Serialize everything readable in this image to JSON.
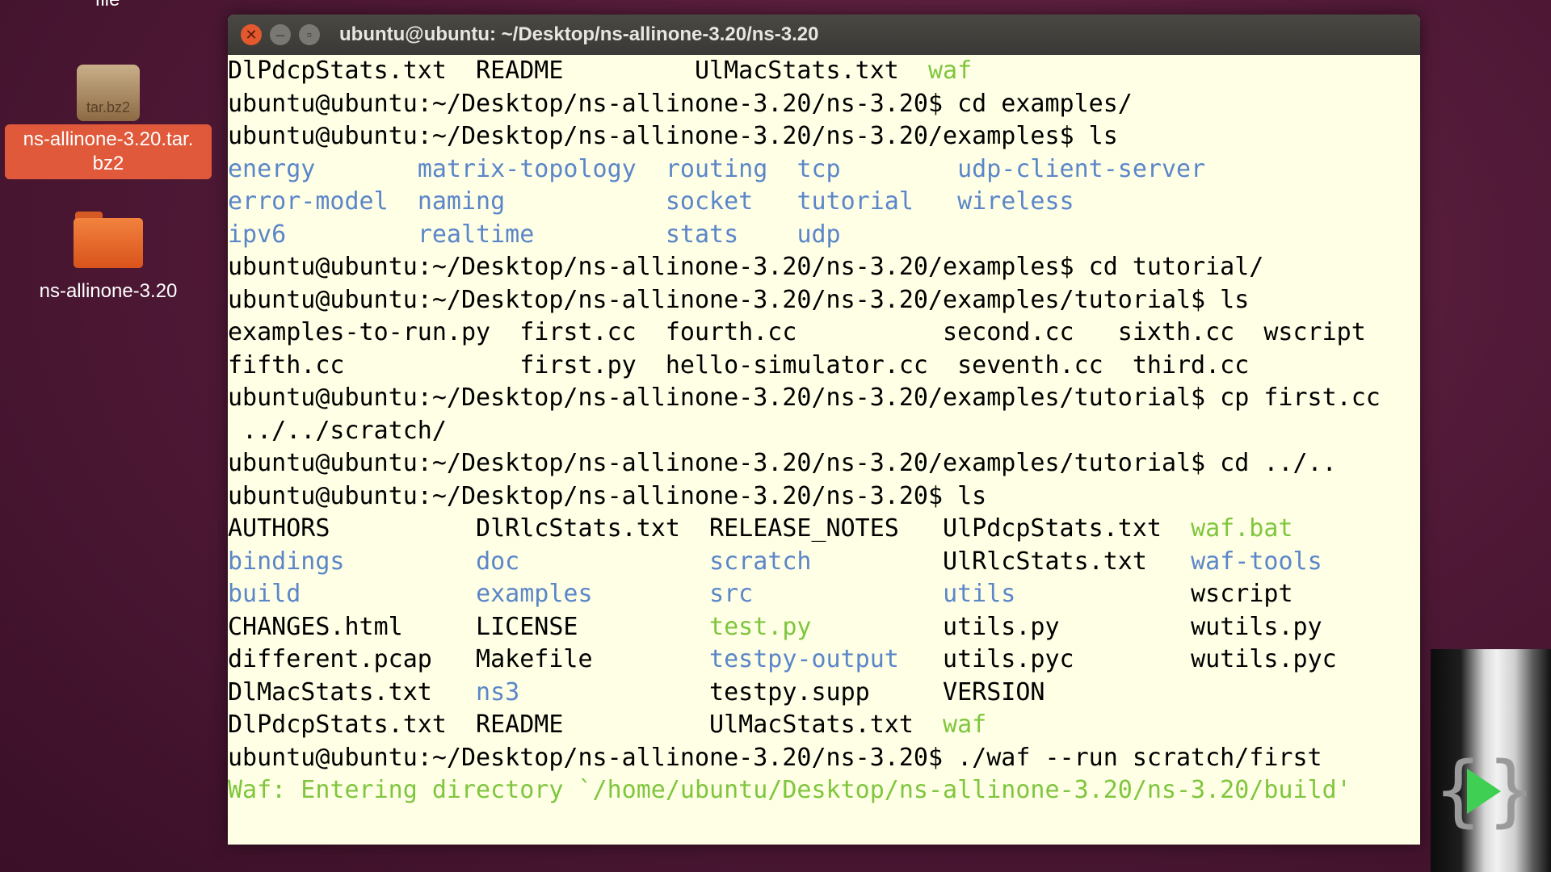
{
  "desktop": {
    "top_clipped_label": "file",
    "icons": [
      {
        "label": "ns-allinone-3.20.tar.\nbz2",
        "thumb_text": "tar.bz2"
      },
      {
        "label": "ns-allinone-3.20"
      }
    ]
  },
  "terminal": {
    "title": "ubuntu@ubuntu: ~/Desktop/ns-allinone-3.20/ns-3.20",
    "lines": [
      [
        {
          "t": "DlPdcpStats.txt  README         UlMacStats.txt  "
        },
        {
          "t": "waf",
          "c": "exe"
        }
      ],
      [
        {
          "t": "ubuntu@ubuntu:~/Desktop/ns-allinone-3.20/ns-3.20$ cd examples/"
        }
      ],
      [
        {
          "t": "ubuntu@ubuntu:~/Desktop/ns-allinone-3.20/ns-3.20/examples$ ls"
        }
      ],
      [
        {
          "t": "energy",
          "c": "dir"
        },
        {
          "t": "       "
        },
        {
          "t": "matrix-topology",
          "c": "dir"
        },
        {
          "t": "  "
        },
        {
          "t": "routing",
          "c": "dir"
        },
        {
          "t": "  "
        },
        {
          "t": "tcp",
          "c": "dir"
        },
        {
          "t": "        "
        },
        {
          "t": "udp-client-server",
          "c": "dir"
        }
      ],
      [
        {
          "t": "error-model",
          "c": "dir"
        },
        {
          "t": "  "
        },
        {
          "t": "naming",
          "c": "dir"
        },
        {
          "t": "           "
        },
        {
          "t": "socket",
          "c": "dir"
        },
        {
          "t": "   "
        },
        {
          "t": "tutorial",
          "c": "dir"
        },
        {
          "t": "   "
        },
        {
          "t": "wireless",
          "c": "dir"
        }
      ],
      [
        {
          "t": "ipv6",
          "c": "dir"
        },
        {
          "t": "         "
        },
        {
          "t": "realtime",
          "c": "dir"
        },
        {
          "t": "         "
        },
        {
          "t": "stats",
          "c": "dir"
        },
        {
          "t": "    "
        },
        {
          "t": "udp",
          "c": "dir"
        }
      ],
      [
        {
          "t": "ubuntu@ubuntu:~/Desktop/ns-allinone-3.20/ns-3.20/examples$ cd tutorial/"
        }
      ],
      [
        {
          "t": "ubuntu@ubuntu:~/Desktop/ns-allinone-3.20/ns-3.20/examples/tutorial$ ls"
        }
      ],
      [
        {
          "t": "examples-to-run.py  first.cc  fourth.cc          second.cc   sixth.cc  wscript"
        }
      ],
      [
        {
          "t": "fifth.cc            first.py  hello-simulator.cc  seventh.cc  third.cc"
        }
      ],
      [
        {
          "t": "ubuntu@ubuntu:~/Desktop/ns-allinone-3.20/ns-3.20/examples/tutorial$ cp first.cc"
        }
      ],
      [
        {
          "t": " ../../scratch/"
        }
      ],
      [
        {
          "t": "ubuntu@ubuntu:~/Desktop/ns-allinone-3.20/ns-3.20/examples/tutorial$ cd ../.."
        }
      ],
      [
        {
          "t": "ubuntu@ubuntu:~/Desktop/ns-allinone-3.20/ns-3.20$ ls"
        }
      ],
      [
        {
          "t": "AUTHORS          DlRlcStats.txt  RELEASE_NOTES   UlPdcpStats.txt  "
        },
        {
          "t": "waf.bat",
          "c": "exe"
        }
      ],
      [
        {
          "t": "bindings",
          "c": "dir"
        },
        {
          "t": "         "
        },
        {
          "t": "doc",
          "c": "dir"
        },
        {
          "t": "             "
        },
        {
          "t": "scratch",
          "c": "dir"
        },
        {
          "t": "         UlRlcStats.txt   "
        },
        {
          "t": "waf-tools",
          "c": "dir"
        }
      ],
      [
        {
          "t": "build",
          "c": "dir"
        },
        {
          "t": "            "
        },
        {
          "t": "examples",
          "c": "dir"
        },
        {
          "t": "        "
        },
        {
          "t": "src",
          "c": "dir"
        },
        {
          "t": "             "
        },
        {
          "t": "utils",
          "c": "dir"
        },
        {
          "t": "            wscript"
        }
      ],
      [
        {
          "t": "CHANGES.html     LICENSE         "
        },
        {
          "t": "test.py",
          "c": "exe"
        },
        {
          "t": "         utils.py         wutils.py"
        }
      ],
      [
        {
          "t": "different.pcap   Makefile        "
        },
        {
          "t": "testpy-output",
          "c": "dir"
        },
        {
          "t": "   utils.pyc        wutils.pyc"
        }
      ],
      [
        {
          "t": "DlMacStats.txt   "
        },
        {
          "t": "ns3",
          "c": "dir"
        },
        {
          "t": "             testpy.supp     VERSION"
        }
      ],
      [
        {
          "t": "DlPdcpStats.txt  README          UlMacStats.txt  "
        },
        {
          "t": "waf",
          "c": "exe"
        }
      ],
      [
        {
          "t": "ubuntu@ubuntu:~/Desktop/ns-allinone-3.20/ns-3.20$ ./waf --run scratch/first"
        }
      ],
      [
        {
          "t": "Waf: Entering directory `/home/ubuntu/Desktop/ns-allinone-3.20/ns-3.20/build'",
          "c": "exe"
        }
      ]
    ]
  },
  "colors": {
    "directory": "#5b86c8",
    "executable": "#7fc63e",
    "terminal_bg": "#ffffe6"
  },
  "icons": {
    "close": "close-icon",
    "minimize": "minimize-icon",
    "maximize": "maximize-icon",
    "archive": "archive-icon",
    "folder": "folder-icon",
    "logo": "play-logo-icon"
  }
}
